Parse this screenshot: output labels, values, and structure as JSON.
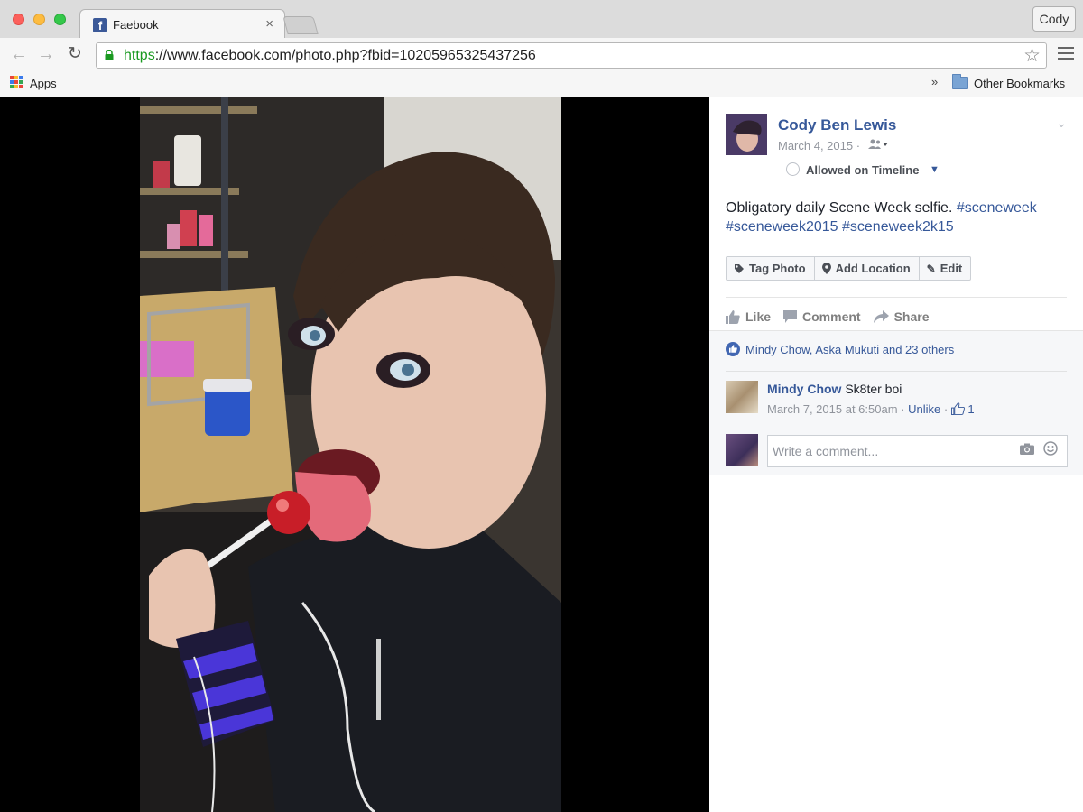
{
  "browser": {
    "tab_title": "Faebook",
    "tab_close": "×",
    "profile_name": "Cody",
    "url_scheme": "https",
    "url_rest": "://www.facebook.com/photo.php?fbid=10205965325437256",
    "apps_label": "Apps",
    "overflow_chevron": "»",
    "other_bookmarks": "Other Bookmarks"
  },
  "post": {
    "author": "Cody Ben Lewis",
    "date": "March 4, 2015",
    "separator": "·",
    "visibility_label": "Allowed on Timeline",
    "caption_text": "Obligatory daily Scene Week selfie. ",
    "hashtags": [
      "#sceneweek",
      "#sceneweek2015",
      "#sceneweek2k15"
    ],
    "buttons": {
      "tag_photo": "Tag Photo",
      "add_location": "Add Location",
      "edit": "Edit"
    },
    "actions": {
      "like": "Like",
      "comment": "Comment",
      "share": "Share"
    },
    "likes_summary": "Mindy Chow, Aska Mukuti and 23 others",
    "comment": {
      "author": "Mindy Chow",
      "text": " Sk8ter boi",
      "timestamp": "March 7, 2015 at 6:50am",
      "unlike": "Unlike",
      "like_count": "1"
    },
    "comment_placeholder": "Write a comment..."
  },
  "icons": {
    "favicon": "facebook-f",
    "back": "←",
    "forward": "→",
    "reload": "↻",
    "star": "☆",
    "tag": "tag",
    "pin": "map-pin",
    "pencil": "✎",
    "thumb": "thumbs-up",
    "speech": "comment-bubble",
    "share_arrow": "share-arrow",
    "camera": "camera",
    "smiley": "smiley"
  },
  "colors": {
    "fb_blue": "#365899",
    "secure_green": "#1a9a21",
    "meta_gray": "#90949c"
  }
}
